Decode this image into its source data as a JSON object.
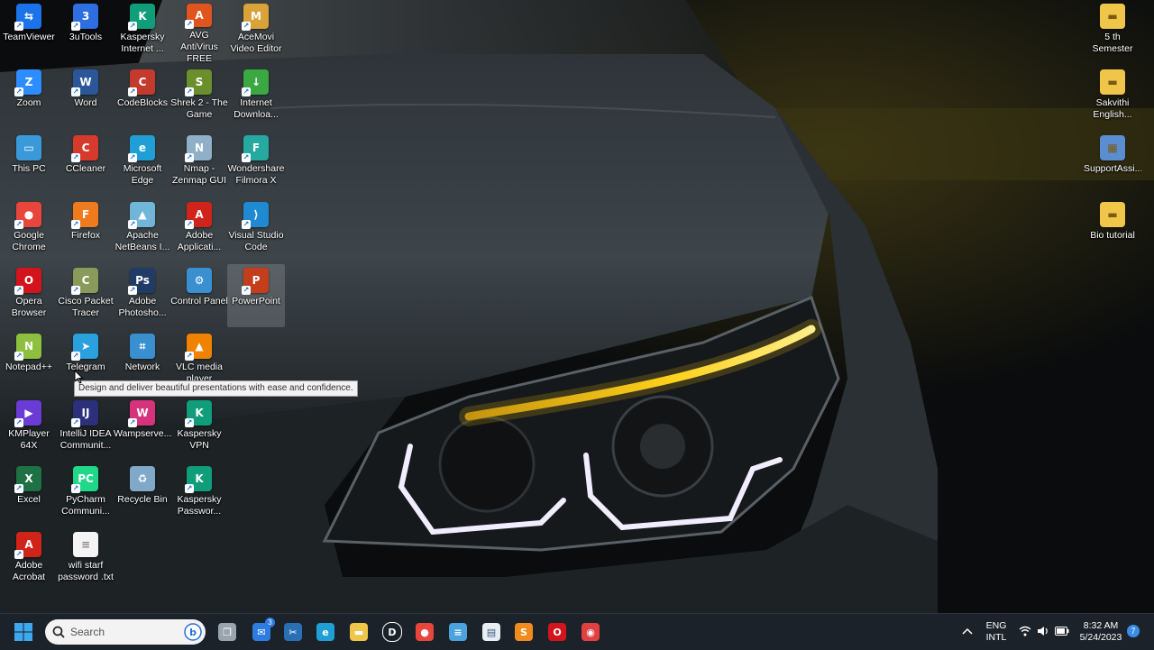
{
  "desktop": {
    "icons": [
      {
        "label": "TeamViewer",
        "color": "#1a73e8",
        "glyph": "⇆"
      },
      {
        "label": "3uTools",
        "color": "#2f6ee0",
        "glyph": "3"
      },
      {
        "label": "Kaspersky Internet ...",
        "color": "#0f9d7a",
        "glyph": "K"
      },
      {
        "label": "AVG AntiVirus FREE",
        "color": "#e0541e",
        "glyph": "A"
      },
      {
        "label": "AceMovi Video Editor",
        "color": "#d9a33a",
        "glyph": "M"
      },
      {
        "label": "Zoom",
        "color": "#2d8cff",
        "glyph": "Z"
      },
      {
        "label": "Word",
        "color": "#2b579a",
        "glyph": "W"
      },
      {
        "label": "CodeBlocks",
        "color": "#c43b2e",
        "glyph": "C"
      },
      {
        "label": "Shrek 2 - The Game",
        "color": "#6a8f2c",
        "glyph": "S"
      },
      {
        "label": "Internet Downloa...",
        "color": "#3aa843",
        "glyph": "↓"
      },
      {
        "label": "This PC",
        "color": "#3a9ad9",
        "glyph": "▭"
      },
      {
        "label": "CCleaner",
        "color": "#d63a2c",
        "glyph": "C"
      },
      {
        "label": "Microsoft Edge",
        "color": "#1f9fd6",
        "glyph": "e"
      },
      {
        "label": "Nmap - Zenmap GUI",
        "color": "#8fb0c8",
        "glyph": "N"
      },
      {
        "label": "Wondershare Filmora X",
        "color": "#25a9a0",
        "glyph": "F"
      },
      {
        "label": "Google Chrome",
        "color": "#e8453c",
        "glyph": "●"
      },
      {
        "label": "Firefox",
        "color": "#f07a1e",
        "glyph": "F"
      },
      {
        "label": "Apache NetBeans I...",
        "color": "#6fb6d9",
        "glyph": "▲"
      },
      {
        "label": "Adobe Applicati...",
        "color": "#d0241b",
        "glyph": "A"
      },
      {
        "label": "Visual Studio Code",
        "color": "#1f8ad2",
        "glyph": "⟩"
      },
      {
        "label": "Opera Browser",
        "color": "#d2141c",
        "glyph": "O"
      },
      {
        "label": "Cisco Packet Tracer",
        "color": "#8a9a5b",
        "glyph": "C"
      },
      {
        "label": "Adobe Photosho...",
        "color": "#1f3b66",
        "glyph": "Ps"
      },
      {
        "label": "Control Panel",
        "color": "#3a8fd1",
        "glyph": "⚙"
      },
      {
        "label": "PowerPoint",
        "color": "#c43e1c",
        "glyph": "P"
      },
      {
        "label": "Notepad++",
        "color": "#8fbf3e",
        "glyph": "N"
      },
      {
        "label": "Telegram",
        "color": "#2aa1de",
        "glyph": "➤"
      },
      {
        "label": "Network",
        "color": "#3a8fd1",
        "glyph": "⌗"
      },
      {
        "label": "VLC media player",
        "color": "#ef8200",
        "glyph": "▲"
      },
      {
        "label": "KMPlayer 64X",
        "color": "#6b3bd6",
        "glyph": "▶"
      },
      {
        "label": "IntelliJ IDEA Communit...",
        "color": "#2c2f7a",
        "glyph": "IJ"
      },
      {
        "label": "Wampserve...",
        "color": "#d6337c",
        "glyph": "W"
      },
      {
        "label": "Kaspersky VPN",
        "color": "#0f9d7a",
        "glyph": "K"
      },
      {
        "label": "Excel",
        "color": "#1e7145",
        "glyph": "X"
      },
      {
        "label": "PyCharm Communi...",
        "color": "#21d789",
        "glyph": "PC"
      },
      {
        "label": "Recycle Bin",
        "color": "#7fa8c9",
        "glyph": "♻"
      },
      {
        "label": "Kaspersky Passwor...",
        "color": "#0f9d7a",
        "glyph": "K"
      },
      {
        "label": "Adobe Acrobat",
        "color": "#d0241b",
        "glyph": "A"
      },
      {
        "label": "wifi starf password .txt",
        "color": "#f4f4f4",
        "glyph": "≡"
      }
    ],
    "right_icons": [
      {
        "label": "5 th Semester",
        "color": "#f0c64a",
        "glyph": "▬"
      },
      {
        "label": "Sakvithi English...",
        "color": "#f0c64a",
        "glyph": "▬"
      },
      {
        "label": "SupportAssi...",
        "color": "#5b8dd1",
        "glyph": "▦"
      },
      {
        "label": "Bio tutorial",
        "color": "#f0c64a",
        "glyph": "▬"
      }
    ],
    "tooltip": "Design and deliver beautiful presentations with ease and confidence."
  },
  "taskbar": {
    "search_placeholder": "Search",
    "mail_badge": "3",
    "lang_line1": "ENG",
    "lang_line2": "INTL",
    "time": "8:32 AM",
    "date": "5/24/2023",
    "notification_count": "7",
    "pinned": [
      {
        "name": "task-view-icon",
        "color": "#9aa4ae",
        "glyph": "❐"
      },
      {
        "name": "mail-icon",
        "color": "#2d7de0",
        "glyph": "✉"
      },
      {
        "name": "snipping-tool-icon",
        "color": "#2a6fb3",
        "glyph": "✂"
      },
      {
        "name": "edge-icon",
        "color": "#1f9fd6",
        "glyph": "e"
      },
      {
        "name": "file-explorer-icon",
        "color": "#f0c64a",
        "glyph": "▬"
      },
      {
        "name": "dell-icon",
        "color": "#1c2229",
        "glyph": "D"
      },
      {
        "name": "chrome-icon",
        "color": "#e8453c",
        "glyph": "●"
      },
      {
        "name": "notepad-icon",
        "color": "#4aa3df",
        "glyph": "≡"
      },
      {
        "name": "document-icon",
        "color": "#e9eef3",
        "glyph": "▤"
      },
      {
        "name": "sublime-icon",
        "color": "#f08c1e",
        "glyph": "S"
      },
      {
        "name": "opera-icon",
        "color": "#d2141c",
        "glyph": "O"
      },
      {
        "name": "record-icon",
        "color": "#e04040",
        "glyph": "◉"
      }
    ]
  }
}
